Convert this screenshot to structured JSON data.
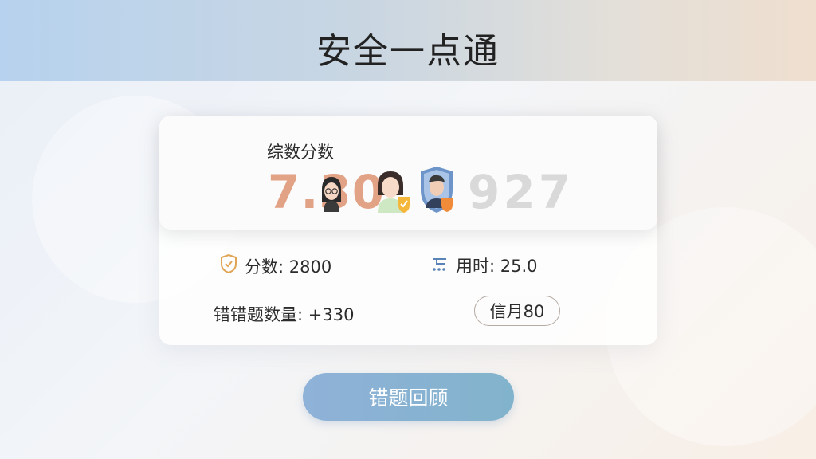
{
  "header": {
    "title": "安全一点通"
  },
  "score_panel": {
    "label": "综数分数",
    "score": "7.30",
    "rank": "927"
  },
  "stats": {
    "score_label": "分数: 2800",
    "time_label": "用时: 25.0",
    "wrong_label": "错错题数量: +330",
    "month_pill": "信月80"
  },
  "review_button": {
    "label": "错题回顾"
  },
  "icons": {
    "score": "shield-check-icon",
    "time": "clock-icon",
    "avatar1": "woman-avatar-icon",
    "avatar2": "woman-shield-avatar-icon",
    "avatar3": "man-shield-avatar-icon"
  },
  "colors": {
    "score": "#e2a285",
    "rank": "#d9d9d9",
    "button": "#88b2d2"
  }
}
